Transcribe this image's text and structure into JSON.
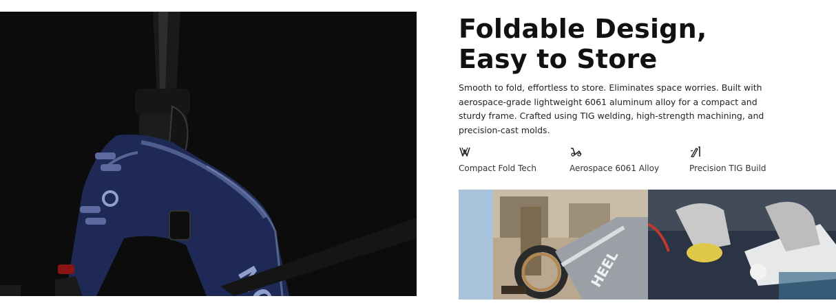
{
  "section": {
    "title": "Foldable Design, Easy to Store",
    "description": "Smooth to fold, effortless to store. Eliminates space worries. Built with aerospace-grade lightweight 6061 aluminum alloy for a compact and sturdy frame. Crafted using TIG welding, high-strength machining, and precision-cast molds."
  },
  "features": [
    {
      "label": "Compact Fold Tech",
      "icon": "fold-icon"
    },
    {
      "label": "Aerospace 6061 Alloy",
      "icon": "alloy-frame-icon"
    },
    {
      "label": "Precision TIG Build",
      "icon": "welding-icon"
    }
  ],
  "colors": {
    "frame_blue": "#1e2a55",
    "text": "#111111",
    "background": "#ffffff"
  }
}
